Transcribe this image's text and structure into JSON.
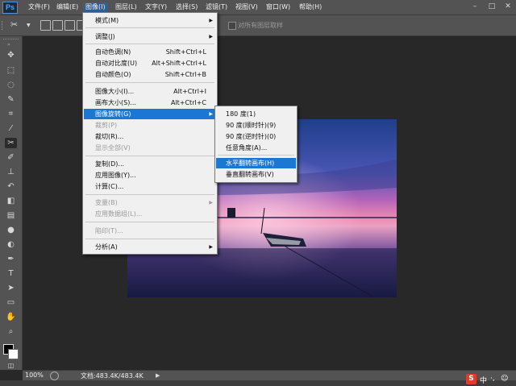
{
  "app": {
    "logo": "Ps"
  },
  "menubar": {
    "items": [
      "文件(F)",
      "编辑(E)",
      "图像(I)",
      "图层(L)",
      "文字(Y)",
      "选择(S)",
      "滤镜(T)",
      "视图(V)",
      "窗口(W)",
      "帮助(H)"
    ],
    "active": "图像(I)",
    "window_controls": [
      "–",
      "□",
      "✕"
    ]
  },
  "options_bar": {
    "checkbox_label": "对所有图层取样"
  },
  "image_menu": {
    "items": [
      {
        "label": "模式(M)",
        "submenu": true
      },
      {
        "label": "调整(J)",
        "submenu": true
      },
      {
        "label": "自动色调(N)",
        "shortcut": "Shift+Ctrl+L"
      },
      {
        "label": "自动对比度(U)",
        "shortcut": "Alt+Shift+Ctrl+L"
      },
      {
        "label": "自动颜色(O)",
        "shortcut": "Shift+Ctrl+B"
      },
      {
        "label": "图像大小(I)...",
        "shortcut": "Alt+Ctrl+I"
      },
      {
        "label": "画布大小(S)...",
        "shortcut": "Alt+Ctrl+C"
      },
      {
        "label": "图像旋转(G)",
        "submenu": true,
        "highlighted": true
      },
      {
        "label": "裁剪(P)",
        "disabled": true
      },
      {
        "label": "裁切(R)..."
      },
      {
        "label": "显示全部(V)",
        "disabled": true
      },
      {
        "label": "复制(D)..."
      },
      {
        "label": "应用图像(Y)..."
      },
      {
        "label": "计算(C)..."
      },
      {
        "label": "变量(B)",
        "submenu": true,
        "disabled": true
      },
      {
        "label": "应用数据组(L)...",
        "disabled": true
      },
      {
        "label": "陷印(T)...",
        "disabled": true
      },
      {
        "label": "分析(A)",
        "submenu": true
      }
    ]
  },
  "rotate_submenu": {
    "items": [
      {
        "label": "180 度(1)"
      },
      {
        "label": "90 度(顺时针)(9)"
      },
      {
        "label": "90 度(逆时针)(0)"
      },
      {
        "label": "任意角度(A)..."
      },
      {
        "label": "水平翻转画布(H)",
        "highlighted": true
      },
      {
        "label": "垂直翻转画布(V)"
      }
    ]
  },
  "status": {
    "zoom": "100%",
    "doc": "文档:483.4K/483.4K"
  },
  "tools": [
    "move-tool",
    "marquee-tool",
    "lasso-tool",
    "quick-select-tool",
    "crop-tool",
    "eyedropper-tool",
    "healing-tool",
    "brush-tool",
    "stamp-tool",
    "history-brush-tool",
    "eraser-tool",
    "gradient-tool",
    "blur-tool",
    "dodge-tool",
    "pen-tool",
    "type-tool",
    "path-select-tool",
    "shape-tool",
    "hand-tool",
    "zoom-tool"
  ],
  "colors": {
    "foreground": "#000000",
    "background": "#ffffff",
    "menu_highlight": "#1a78d4",
    "ui_panel": "#535353",
    "workspace": "#282828"
  }
}
